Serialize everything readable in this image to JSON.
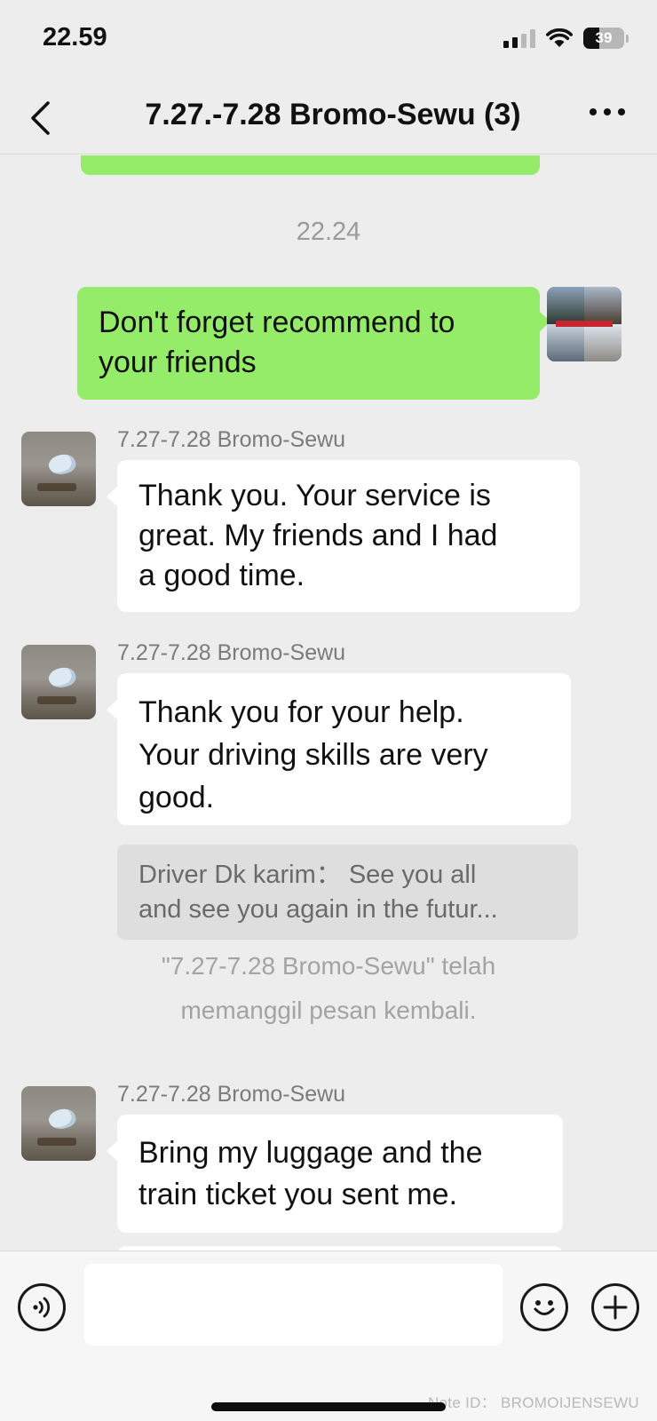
{
  "status_bar": {
    "time": "22.59",
    "battery": "39",
    "icons": [
      "signal-icon",
      "wifi-icon",
      "battery-icon"
    ]
  },
  "header": {
    "title": "7.27.-7.28 Bromo-Sewu (3)",
    "back_icon": "chevron-left-icon",
    "more_icon": "more-dots-icon"
  },
  "chat": {
    "timestamp": "22.24",
    "messages": [
      {
        "from": "self",
        "lines": [
          "Don't forget recommend to",
          "your friends"
        ]
      },
      {
        "from": "other",
        "sender": "7.27-7.28 Bromo-Sewu",
        "lines": [
          "Thank you. Your service is",
          "great. My friends and I had",
          "a good time."
        ]
      },
      {
        "from": "other",
        "sender": "7.27-7.28 Bromo-Sewu",
        "lines": [
          "Thank you for your help.",
          "Your driving skills are very",
          "good."
        ],
        "quote": {
          "line1": "Driver Dk karim：  See you all",
          "line2": "and see you again in the futur..."
        }
      },
      {
        "from": "other",
        "sender": "7.27-7.28 Bromo-Sewu",
        "lines": [
          "Bring my luggage and the",
          "train ticket you sent me."
        ]
      }
    ],
    "system_note": {
      "line1": "\"7.27-7.28 Bromo-Sewu\" telah",
      "line2": "memanggil pesan kembali."
    }
  },
  "input_bar": {
    "message_value": "",
    "voice_icon": "voice-icon",
    "emoji_icon": "emoji-icon",
    "plus_icon": "plus-icon",
    "watermark": "Note ID：  BROMOIJENSEWU"
  },
  "colors": {
    "self_bubble": "#95ec69",
    "other_bubble": "#ffffff",
    "background": "#ededed"
  }
}
